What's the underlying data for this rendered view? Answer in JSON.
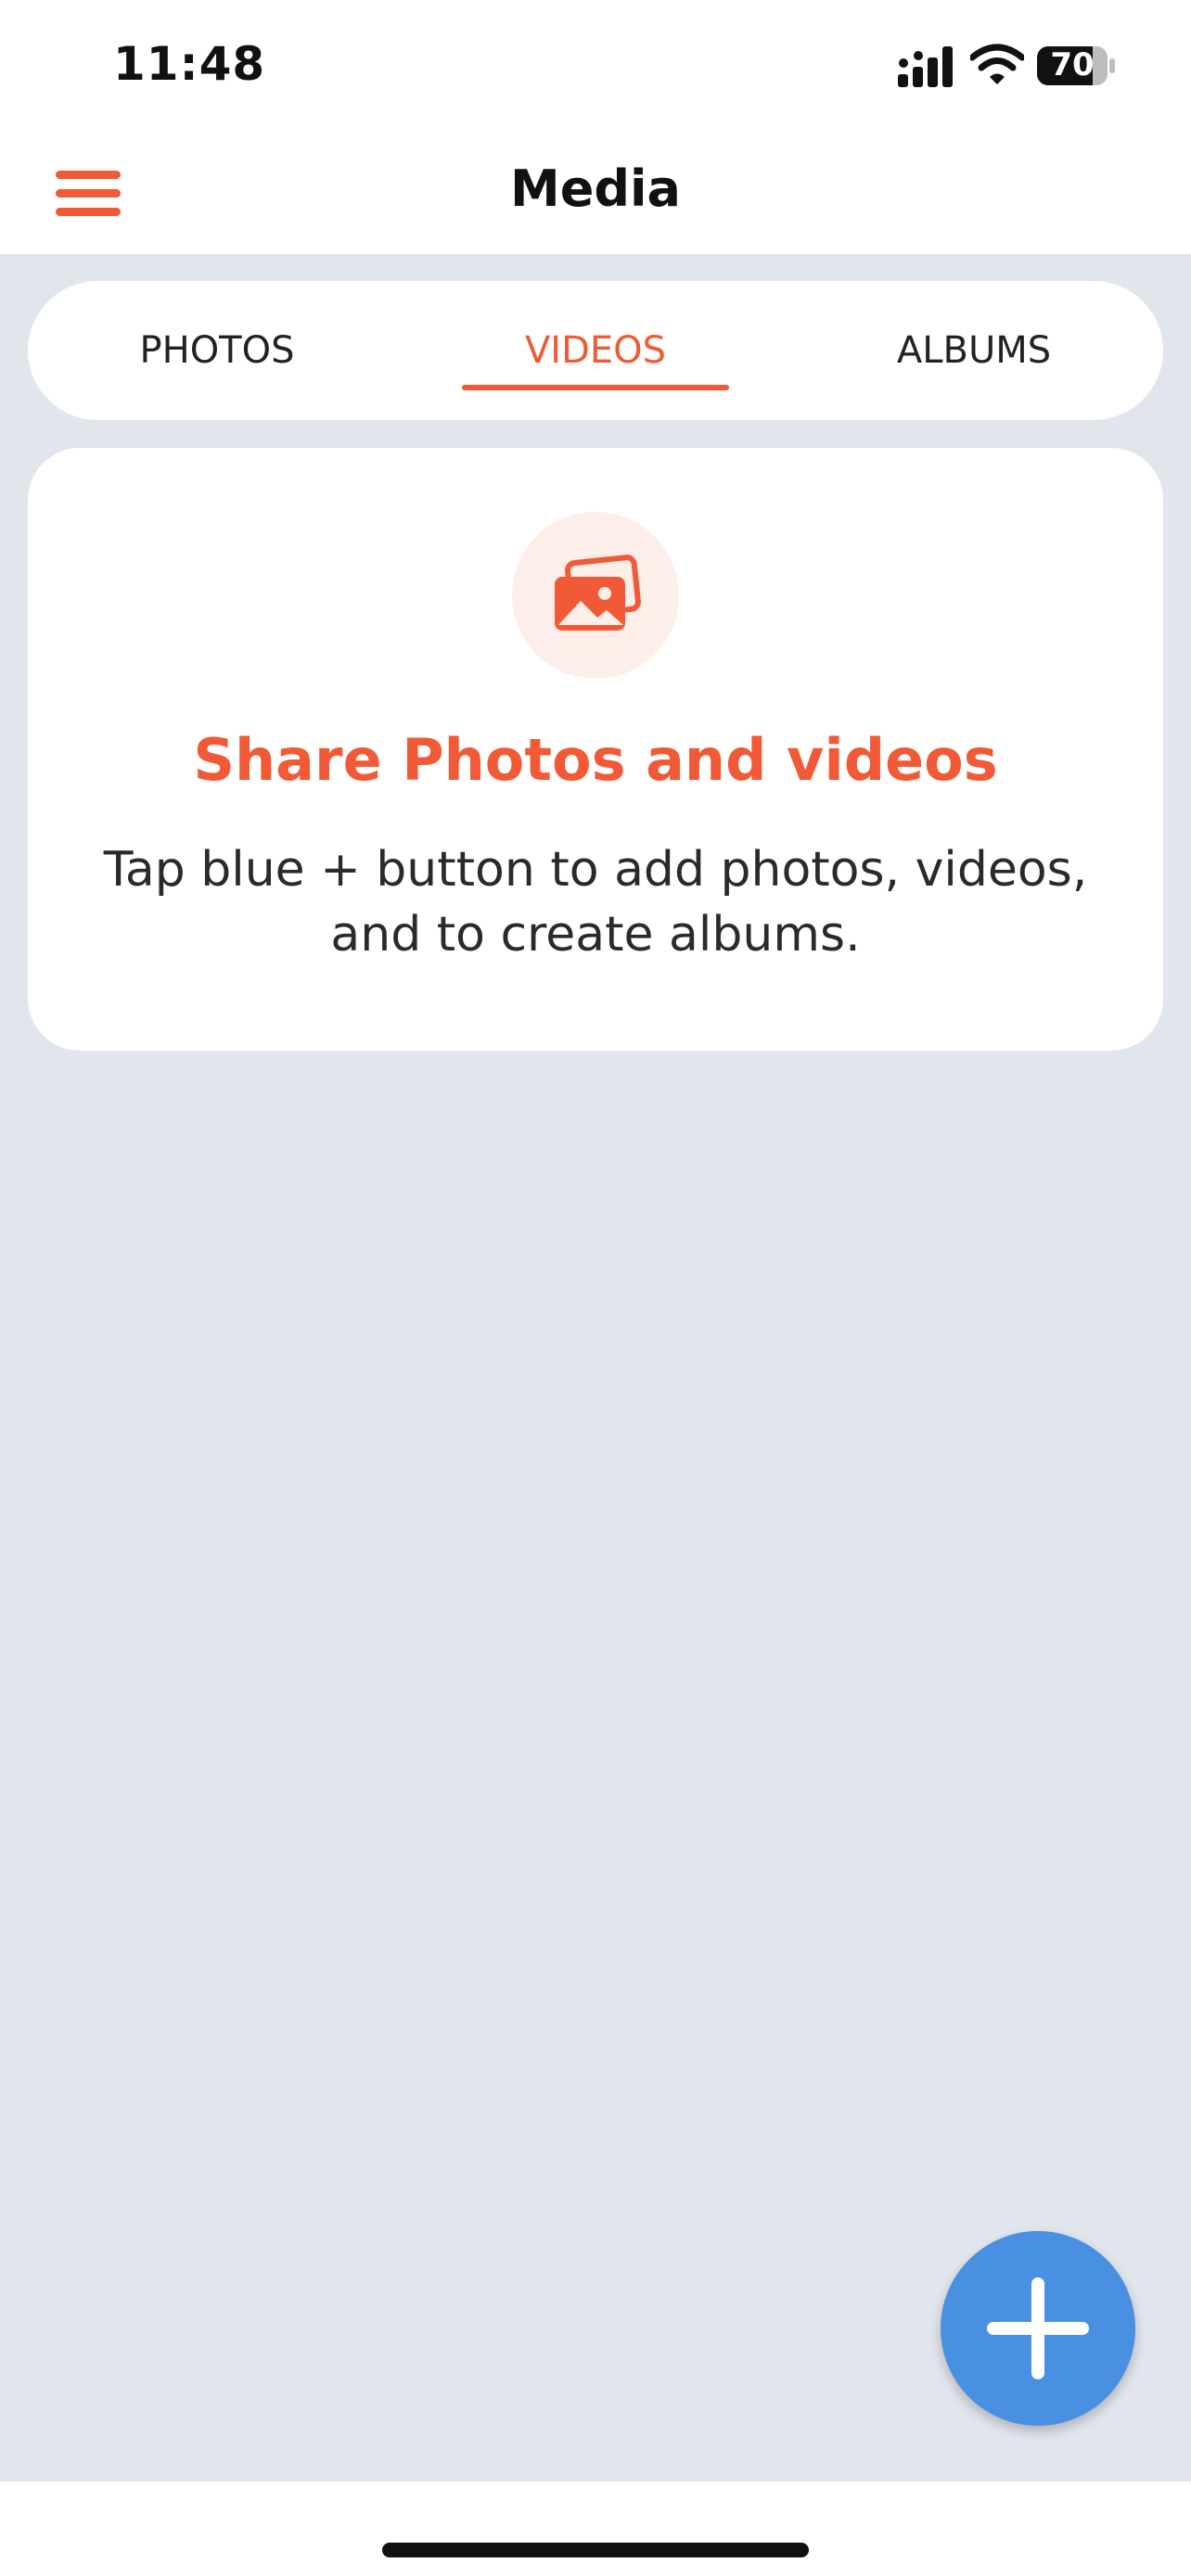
{
  "status_bar": {
    "time": "11:48",
    "battery": "70",
    "icons": [
      "signal-icon",
      "wifi-icon",
      "battery-icon"
    ]
  },
  "header": {
    "title": "Media",
    "menu_icon": "hamburger-menu-icon"
  },
  "tabs": [
    {
      "label": "PHOTOS",
      "active": false
    },
    {
      "label": "VIDEOS",
      "active": true
    },
    {
      "label": "ALBUMS",
      "active": false
    }
  ],
  "empty_state": {
    "icon": "photos-icon",
    "title": "Share Photos and videos",
    "text": "Tap blue + button to add photos, videos, and to create albums."
  },
  "fab": {
    "icon": "plus-icon"
  },
  "colors": {
    "accent": "#F15A36",
    "fab": "#4A90E2",
    "background": "#E1E5EC",
    "icon_bg": "#FDEEEA"
  }
}
